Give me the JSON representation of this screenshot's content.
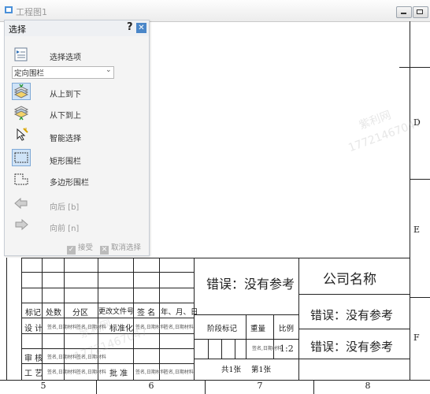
{
  "window": {
    "title": "工程图1"
  },
  "panel": {
    "title": "选择",
    "help": "?",
    "close": "✕",
    "options_label": "选择选项",
    "dropdown_value": "定向围栏",
    "dropdown_arrow": "⌄",
    "tools": [
      {
        "label": "从上到下"
      },
      {
        "label": "从下到上"
      },
      {
        "label": "智能选择"
      },
      {
        "label": "矩形围栏"
      },
      {
        "label": "多边形围栏"
      },
      {
        "label": "向后 [b]"
      },
      {
        "label": "向前 [n]"
      }
    ],
    "accept": "接受",
    "cancel": "取消选择"
  },
  "border": {
    "side_labels": [
      "D",
      "E",
      "F"
    ],
    "bottom_numbers": [
      "5",
      "6",
      "7",
      "8"
    ]
  },
  "title_block": {
    "error_main": "错误：没有参考",
    "company": "公司名称",
    "error_right_1": "错误：没有参考",
    "error_right_2": "错误：没有参考",
    "rev_headers": [
      "标记",
      "处数",
      "分区",
      "更改文件号",
      "签 名",
      "年、月、日"
    ],
    "row_design": "设 计",
    "row_standard": "标准化",
    "row_review": "审 核",
    "row_process": "工 艺",
    "row_approve": "批 准",
    "stage_mark": "阶段标记",
    "weight": "重量",
    "scale": "比例",
    "scale_value": "1:2",
    "sheets": "共1张",
    "sheet_no": "第1张",
    "small_placeholder": "签名,日期材料"
  },
  "watermarks": [
    "紫利网",
    "17721467047"
  ]
}
